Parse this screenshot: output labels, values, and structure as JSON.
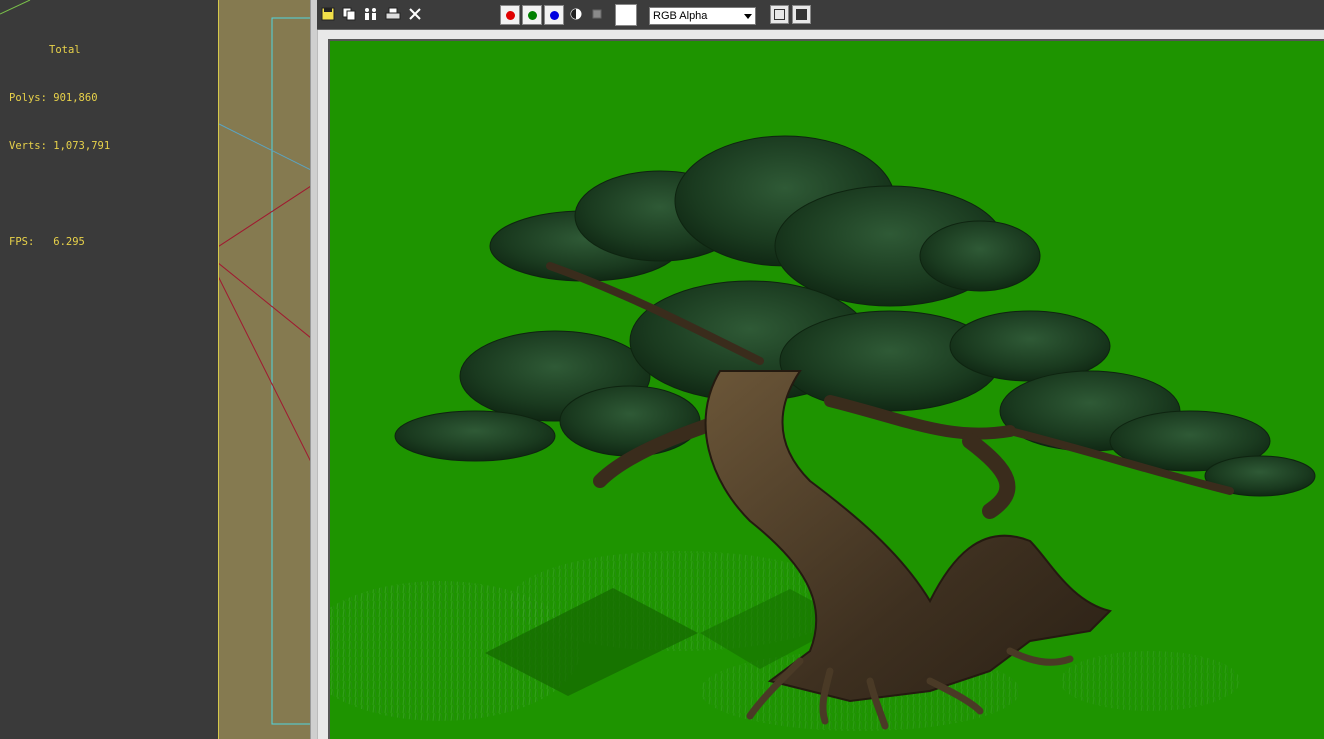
{
  "left_viewport": {
    "stats": {
      "total_label": "Total",
      "polys_label": "Polys:",
      "polys_value": "901,860",
      "verts_label": "Verts:",
      "verts_value": "1,073,791",
      "fps_label": "FPS:",
      "fps_value": "6.295"
    }
  },
  "render_window": {
    "toolbar": {
      "icons": [
        "save-icon",
        "copy-icon",
        "clone-icon",
        "print-icon",
        "clear-icon"
      ],
      "channels": [
        {
          "name": "red-channel",
          "color": "#e00000"
        },
        {
          "name": "green-channel",
          "color": "#008000"
        },
        {
          "name": "blue-channel",
          "color": "#0000e0"
        }
      ],
      "channel_select_value": "RGB Alpha"
    },
    "background_color": "#1e9400"
  }
}
